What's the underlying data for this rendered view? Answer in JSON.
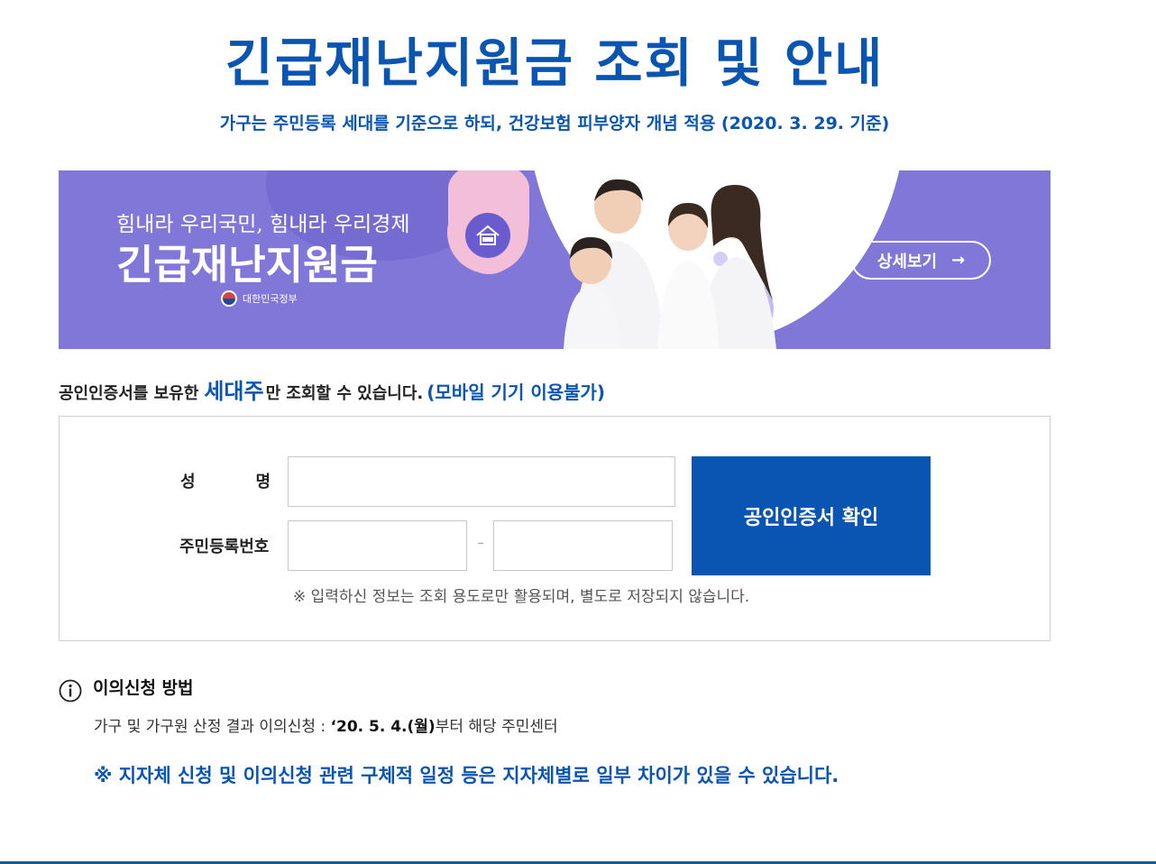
{
  "header": {
    "title": "긴급재난지원금 조회 및 안내",
    "subtitle": "가구는 주민등록 세대를 기준으로 하되, 건강보험 피부양자 개념 적용 (2020. 3. 29. 기준)"
  },
  "banner": {
    "slogan": "힘내라 우리국민, 힘내라 우리경제",
    "title": "긴급재난지원금",
    "gov_label": "대한민국정부",
    "detail_button": "상세보기",
    "detail_arrow": "→"
  },
  "notice": {
    "prefix": "공인인증서를 보유한",
    "emphasis": "세대주",
    "suffix": "만 조회할 수 있습니다.",
    "mobile": "(모바일 기기 이용불가)"
  },
  "form": {
    "name_label_1": "성",
    "name_label_2": "명",
    "rrn_label": "주민등록번호",
    "dash": "–",
    "name_value": "",
    "rrn_front_value": "",
    "rrn_back_value": "",
    "confirm_button": "공인인증서 확인",
    "privacy_note": "※ 입력하신 정보는 조회 용도로만 활용되며, 별도로 저장되지 않습니다."
  },
  "objection": {
    "title": "이의신청 방법",
    "text_prefix": "가구 및 가구원 산정 결과 이의신청 :",
    "text_date": "‘20. 5. 4.(월)",
    "text_suffix": "부터 해당 주민센터",
    "bottom_note": "※ 지자체 신청 및 이의신청 관련 구체적 일정 등은 지자체별로 일부 차이가 있을 수 있습니다."
  },
  "colors": {
    "brand_blue": "#0a55b2",
    "banner_purple": "#8177d9",
    "banner_pink": "#f3bed8"
  }
}
